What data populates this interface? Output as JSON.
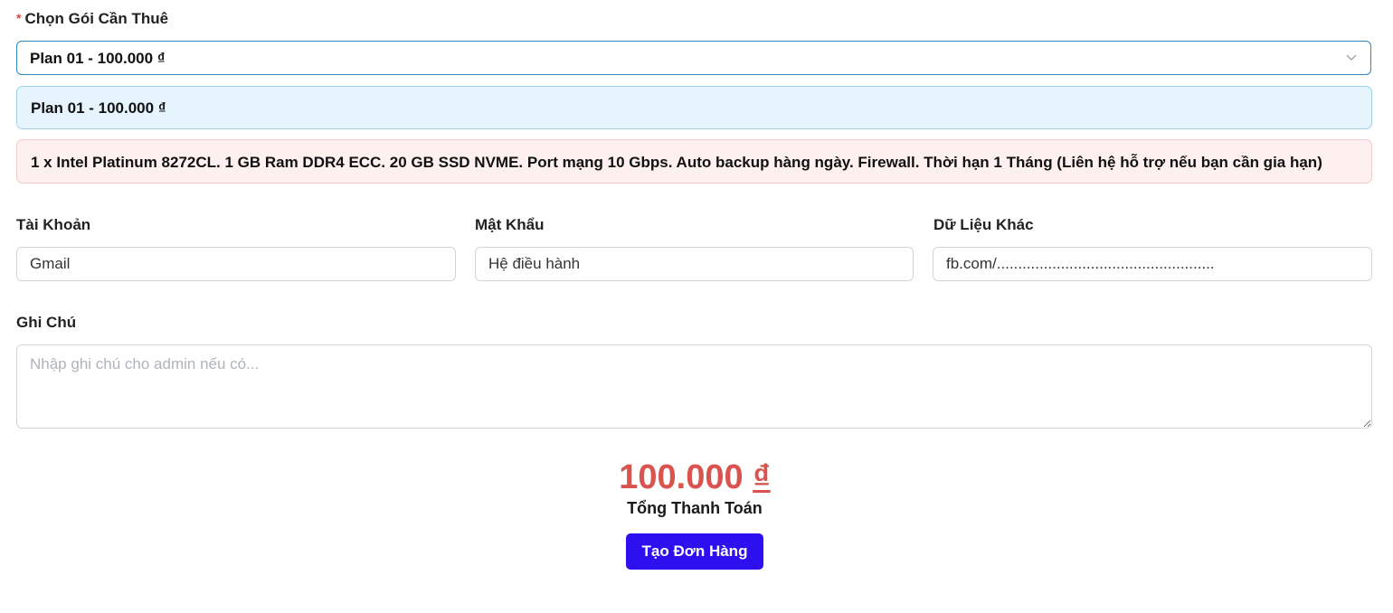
{
  "plan_section": {
    "required_mark": "*",
    "label": "Chọn Gói Cần Thuê",
    "selected_value": "Plan 01 - 100.000 ₫",
    "info_title": "Plan 01 - 100.000 ₫",
    "description": "1 x Intel Platinum 8272CL. 1 GB Ram DDR4 ECC. 20 GB SSD NVME. Port mạng 10 Gbps. Auto backup hàng ngày. Firewall. Thời hạn 1 Tháng (Liên hệ hỗ trợ nếu bạn cần gia hạn)",
    "chevron_icon": "chevron-down-icon"
  },
  "fields": {
    "account": {
      "label": "Tài Khoản",
      "value": "Gmail"
    },
    "password": {
      "label": "Mật Khẩu",
      "value": "Hệ điều hành"
    },
    "other": {
      "label": "Dữ Liệu Khác",
      "value": "fb.com/..................................................."
    }
  },
  "note": {
    "label": "Ghi Chú",
    "placeholder": "Nhập ghi chú cho admin nếu có..."
  },
  "total": {
    "amount": "100.000",
    "currency": "₫",
    "label": "Tổng Thanh Toán"
  },
  "submit_label": "Tạo Đơn Hàng",
  "colors": {
    "accent_button": "#2d0ff0",
    "total_amount": "#d9534f",
    "select_border": "#2a8bb8",
    "info_bg": "#e6f4fe",
    "desc_bg": "#fff0f0"
  }
}
